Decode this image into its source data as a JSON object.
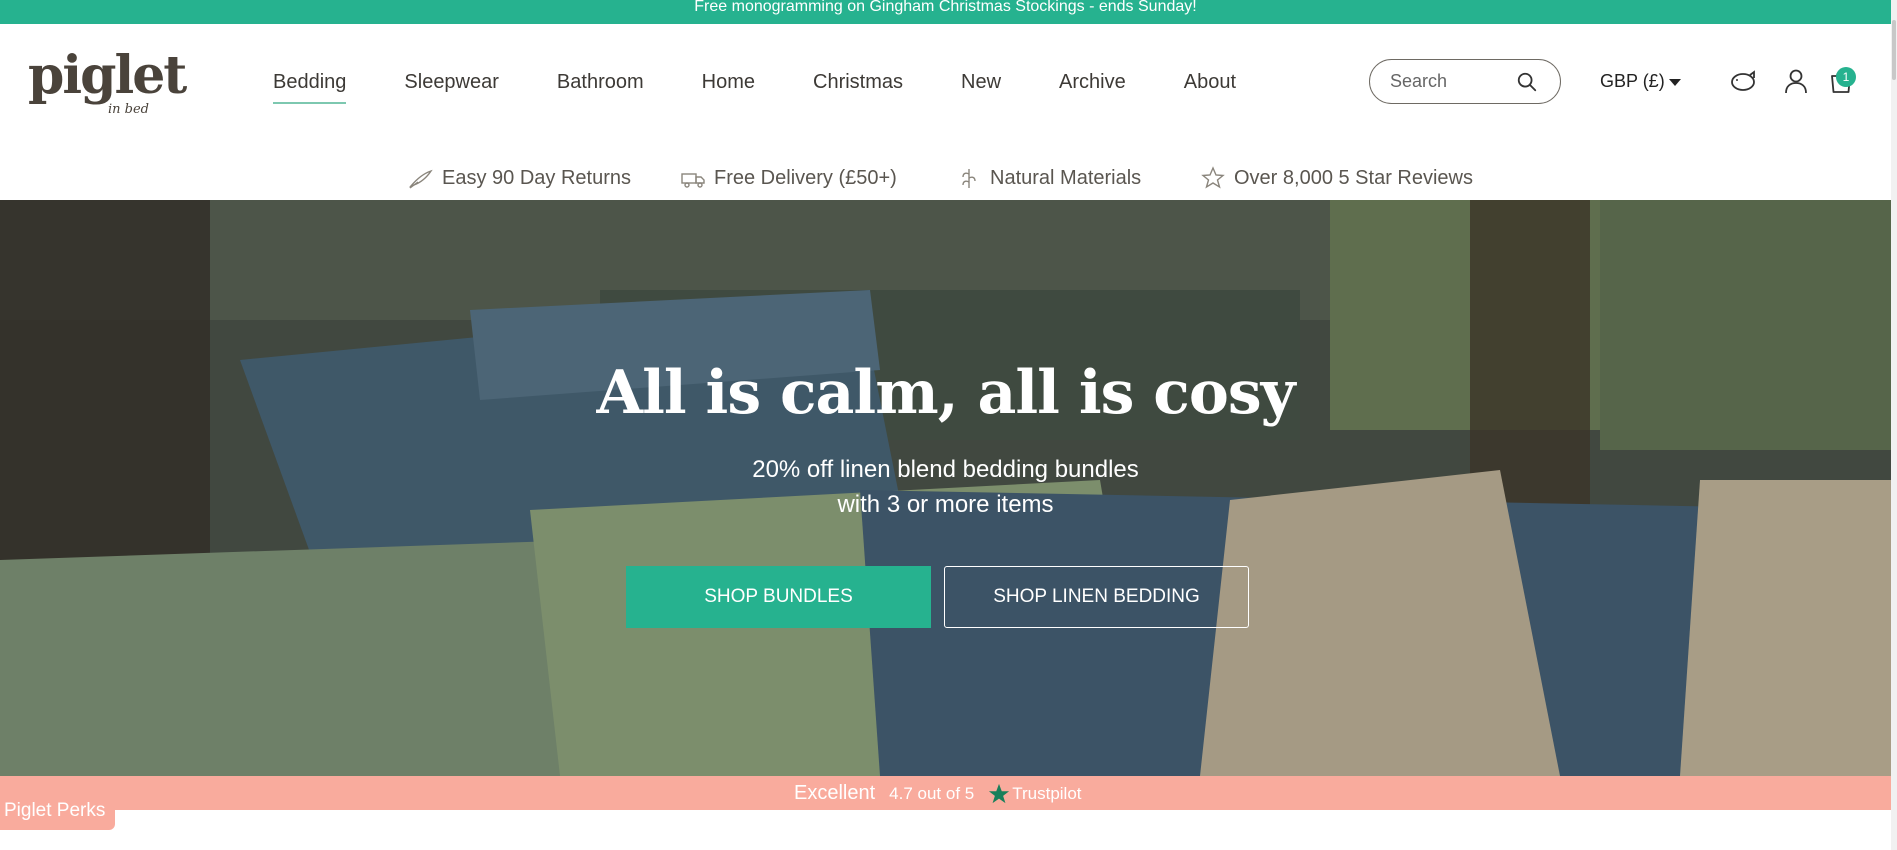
{
  "announcement": "Free monogramming on Gingham Christmas Stockings - ends Sunday!",
  "brand": {
    "logo_text": "piglet",
    "logo_script": "in bed"
  },
  "nav": {
    "items": [
      {
        "label": "Bedding",
        "active": true
      },
      {
        "label": "Sleepwear"
      },
      {
        "label": "Bathroom"
      },
      {
        "label": "Home"
      },
      {
        "label": "Christmas"
      },
      {
        "label": "New"
      },
      {
        "label": "Archive"
      },
      {
        "label": "About"
      }
    ]
  },
  "search": {
    "placeholder": "Search"
  },
  "currency": {
    "label": "GBP (£)"
  },
  "cart": {
    "count": "1"
  },
  "usps": [
    {
      "label": "Easy 90 Day Returns",
      "icon": "feather-icon"
    },
    {
      "label": "Free Delivery (£50+)",
      "icon": "delivery-icon"
    },
    {
      "label": "Natural Materials",
      "icon": "flax-icon"
    },
    {
      "label": "Over 8,000 5 Star Reviews",
      "icon": "star-icon"
    }
  ],
  "hero": {
    "title": "All is calm, all is cosy",
    "subtitle_line1": "20% off linen blend bedding bundles",
    "subtitle_line2": "with 3 or more items",
    "primary_cta": "SHOP BUNDLES",
    "secondary_cta": "SHOP LINEN BEDDING"
  },
  "trustpilot": {
    "rating_word": "Excellent",
    "score": "4.7 out of 5",
    "brand": "Trustpilot"
  },
  "perks": {
    "label": "Piglet Perks"
  },
  "colors": {
    "accent": "#26b28f",
    "trust_bar": "#f9ab9d",
    "text": "#3d3a36"
  }
}
